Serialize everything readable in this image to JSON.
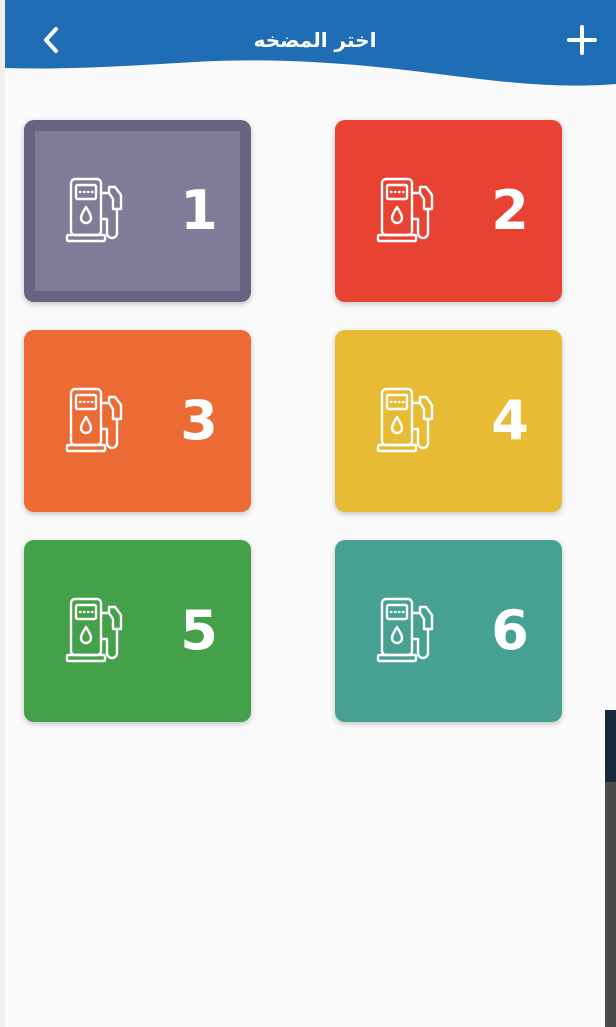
{
  "header": {
    "title": "اختر المضخه",
    "back_icon": "chevron-left-icon",
    "add_icon": "plus-icon",
    "background_color": "#1f6db5"
  },
  "pumps": [
    {
      "number": "1",
      "color": "#7f7c97",
      "selected": true,
      "icon": "fuel-pump-icon"
    },
    {
      "number": "2",
      "color": "#e84233",
      "selected": false,
      "icon": "fuel-pump-icon"
    },
    {
      "number": "3",
      "color": "#ec6a34",
      "selected": false,
      "icon": "fuel-pump-icon"
    },
    {
      "number": "4",
      "color": "#e8bb35",
      "selected": false,
      "icon": "fuel-pump-icon"
    },
    {
      "number": "5",
      "color": "#45a04a",
      "selected": false,
      "icon": "fuel-pump-icon"
    },
    {
      "number": "6",
      "color": "#46a193",
      "selected": false,
      "icon": "fuel-pump-icon"
    }
  ]
}
